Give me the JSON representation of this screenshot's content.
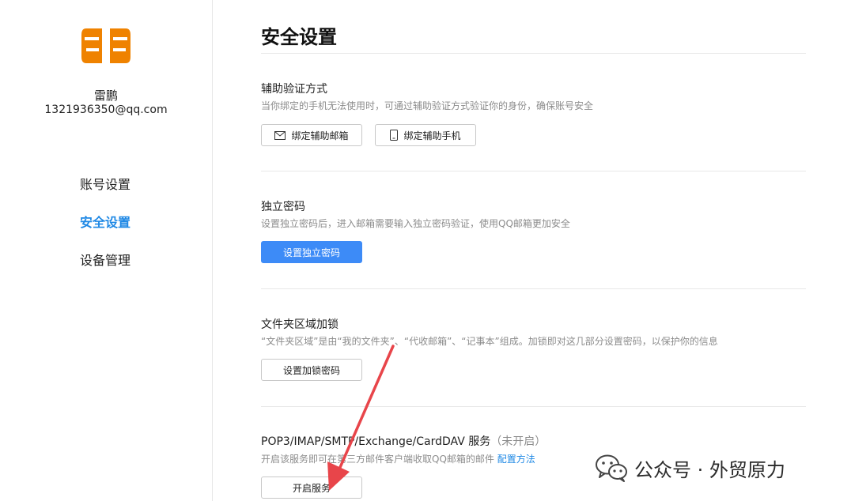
{
  "profile": {
    "name": "雷鹏",
    "email": "1321936350@qq.com"
  },
  "sidebar": {
    "items": [
      {
        "label": "账号设置",
        "active": false
      },
      {
        "label": "安全设置",
        "active": true
      },
      {
        "label": "设备管理",
        "active": false
      }
    ]
  },
  "main": {
    "title": "安全设置",
    "sections": [
      {
        "title": "辅助验证方式",
        "desc": "当你绑定的手机无法使用时，可通过辅助验证方式验证你的身份，确保账号安全",
        "buttons": [
          {
            "label": "绑定辅助邮箱",
            "icon": "mail-icon"
          },
          {
            "label": "绑定辅助手机",
            "icon": "phone-icon"
          }
        ]
      },
      {
        "title": "独立密码",
        "desc": "设置独立密码后，进入邮箱需要输入独立密码验证，使用QQ邮箱更加安全",
        "buttons": [
          {
            "label": "设置独立密码",
            "primary": true
          }
        ]
      },
      {
        "title": "文件夹区域加锁",
        "desc": "“文件夹区域”是由“我的文件夹”、“代收邮箱”、“记事本”组成。加锁即对这几部分设置密码，以保护你的信息",
        "buttons": [
          {
            "label": "设置加锁密码"
          }
        ]
      },
      {
        "title": "POP3/IMAP/SMTP/Exchange/CardDAV 服务",
        "status": "（未开启）",
        "desc": "开启该服务即可在第三方邮件客户端收取QQ邮箱的邮件",
        "link": "配置方法",
        "buttons": [
          {
            "label": "开启服务"
          }
        ]
      }
    ]
  },
  "watermark": {
    "text": "公众号 · 外贸原力",
    "icon": "wechat-icon"
  },
  "colors": {
    "accent": "#1e88e5",
    "primary_button": "#3d8bf7",
    "arrow": "#e8454a",
    "avatar": "#ef8200"
  }
}
